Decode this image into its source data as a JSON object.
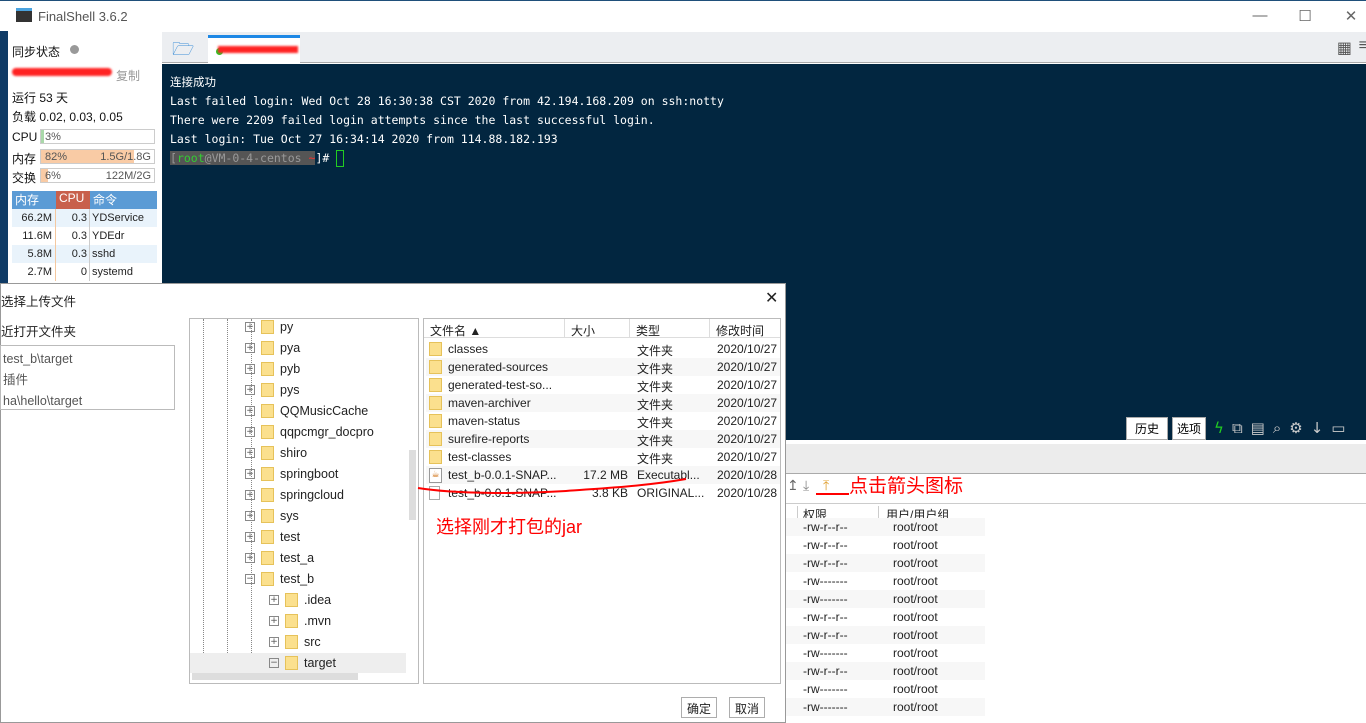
{
  "app": {
    "title": "FinalShell 3.6.2"
  },
  "window_controls": {
    "minimize": "—",
    "maximize": "☐",
    "close": "✕"
  },
  "sidebar": {
    "sync_status": "同步状态",
    "copy": "复制",
    "uptime": "运行 53 天",
    "load": "负载 0.02, 0.03, 0.05",
    "cpu": {
      "label": "CPU",
      "percent_text": "3%",
      "percent": 3
    },
    "mem": {
      "label": "内存",
      "percent_text": "82%",
      "percent": 82,
      "usage": "1.5G/1.8G"
    },
    "swap": {
      "label": "交换",
      "percent_text": "6%",
      "percent": 6,
      "usage": "122M/2G"
    },
    "proc_headers": [
      "内存",
      "CPU",
      "命令"
    ],
    "procs": [
      {
        "mem": "66.2M",
        "cpu": "0.3",
        "cmd": "YDService"
      },
      {
        "mem": "11.6M",
        "cpu": "0.3",
        "cmd": "YDEdr"
      },
      {
        "mem": "5.8M",
        "cpu": "0.3",
        "cmd": "sshd"
      },
      {
        "mem": "2.7M",
        "cpu": "0",
        "cmd": "systemd"
      }
    ]
  },
  "terminal": {
    "lines": [
      "连接成功",
      "Last failed login: Wed Oct 28 16:30:38 CST 2020 from 42.194.168.209 on ssh:notty",
      "There were 2209 failed login attempts since the last successful login.",
      "Last login: Tue Oct 27 16:34:14 2020 from 114.88.182.193"
    ],
    "prompt_user": "root",
    "prompt_host": "@VM-0-4-centos",
    "prompt_tilde": "~",
    "prompt_end": "]#",
    "history_btn": "历史",
    "options_btn": "选项"
  },
  "remote_files": {
    "headers": [
      "权限",
      "用户/用户组"
    ],
    "rows": [
      [
        "-rw-r--r--",
        "root/root"
      ],
      [
        "-rw-r--r--",
        "root/root"
      ],
      [
        "-rw-r--r--",
        "root/root"
      ],
      [
        "-rw-------",
        "root/root"
      ],
      [
        "-rw-------",
        "root/root"
      ],
      [
        "-rw-r--r--",
        "root/root"
      ],
      [
        "-rw-r--r--",
        "root/root"
      ],
      [
        "-rw-------",
        "root/root"
      ],
      [
        "-rw-r--r--",
        "root/root"
      ],
      [
        "-rw-------",
        "root/root"
      ],
      [
        "-rw-------",
        "root/root"
      ]
    ]
  },
  "dialog": {
    "title": "选择上传文件",
    "recent_label": "近打开文件夹",
    "recent": [
      "test_b\\target",
      "插件",
      "ha\\hello\\target"
    ],
    "tree": [
      {
        "name": "py",
        "level": 1,
        "expanded": false
      },
      {
        "name": "pya",
        "level": 1,
        "expanded": false
      },
      {
        "name": "pyb",
        "level": 1,
        "expanded": false
      },
      {
        "name": "pys",
        "level": 1,
        "expanded": false
      },
      {
        "name": "QQMusicCache",
        "level": 1,
        "expanded": false
      },
      {
        "name": "qqpcmgr_docpro",
        "level": 1,
        "expanded": false
      },
      {
        "name": "shiro",
        "level": 1,
        "expanded": false
      },
      {
        "name": "springboot",
        "level": 1,
        "expanded": false
      },
      {
        "name": "springcloud",
        "level": 1,
        "expanded": false
      },
      {
        "name": "sys",
        "level": 1,
        "expanded": false
      },
      {
        "name": "test",
        "level": 1,
        "expanded": false
      },
      {
        "name": "test_a",
        "level": 1,
        "expanded": false
      },
      {
        "name": "test_b",
        "level": 1,
        "expanded": true
      },
      {
        "name": ".idea",
        "level": 2,
        "expanded": false
      },
      {
        "name": ".mvn",
        "level": 2,
        "expanded": false
      },
      {
        "name": "src",
        "level": 2,
        "expanded": false
      },
      {
        "name": "target",
        "level": 2,
        "expanded": true,
        "selected": true
      }
    ],
    "file_headers": [
      "文件名 ▲",
      "大小",
      "类型",
      "修改时间"
    ],
    "files": [
      {
        "name": "classes",
        "size": "",
        "type": "文件夹",
        "date": "2020/10/27",
        "icon": "folder"
      },
      {
        "name": "generated-sources",
        "size": "",
        "type": "文件夹",
        "date": "2020/10/27",
        "icon": "folder"
      },
      {
        "name": "generated-test-so...",
        "size": "",
        "type": "文件夹",
        "date": "2020/10/27",
        "icon": "folder"
      },
      {
        "name": "maven-archiver",
        "size": "",
        "type": "文件夹",
        "date": "2020/10/27",
        "icon": "folder"
      },
      {
        "name": "maven-status",
        "size": "",
        "type": "文件夹",
        "date": "2020/10/27",
        "icon": "folder"
      },
      {
        "name": "surefire-reports",
        "size": "",
        "type": "文件夹",
        "date": "2020/10/27",
        "icon": "folder"
      },
      {
        "name": "test-classes",
        "size": "",
        "type": "文件夹",
        "date": "2020/10/27",
        "icon": "folder"
      },
      {
        "name": "test_b-0.0.1-SNAP...",
        "size": "17.2 MB",
        "type": "Executabl...",
        "date": "2020/10/28",
        "icon": "jar"
      },
      {
        "name": "test_b-0.0.1-SNAP...",
        "size": "3.8 KB",
        "type": "ORIGINAL...",
        "date": "2020/10/28",
        "icon": "file"
      }
    ],
    "ok": "确定",
    "cancel": "取消"
  },
  "annotations": {
    "click_arrow": "点击箭头图标",
    "select_jar": "选择刚才打包的jar"
  },
  "colors": {
    "terminal_bg": "#022640",
    "accent": "#1e88e5",
    "annotation": "#ff0000",
    "mem_bar": "#f9cba5",
    "cpu_bar": "#a9d8a9"
  }
}
